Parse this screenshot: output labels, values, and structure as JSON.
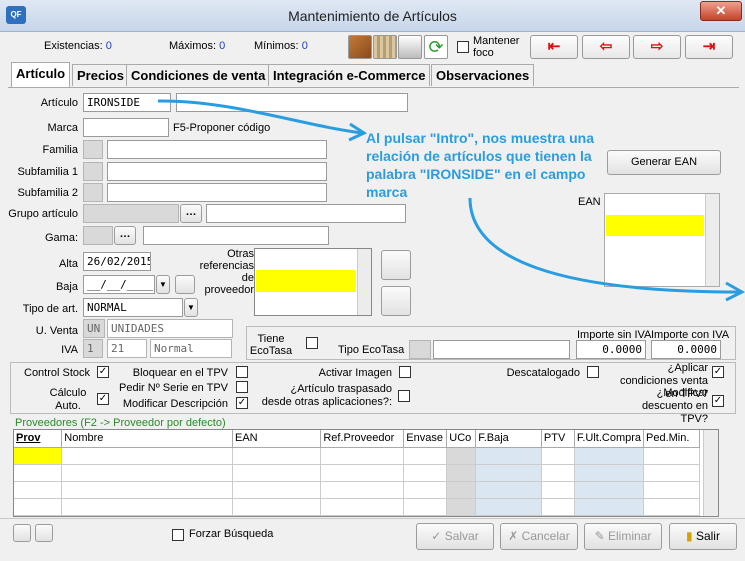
{
  "window": {
    "title": "Mantenimiento de Artículos",
    "app_icon": "QF"
  },
  "stats": {
    "existencias_label": "Existencias:",
    "existencias_value": "0",
    "maximos_label": "Máximos:",
    "maximos_value": "0",
    "minimos_label": "Mínimos:",
    "minimos_value": "0"
  },
  "toolbar": {
    "mantener_foco_label": "Mantener foco"
  },
  "tabs": [
    "Artículo",
    "Precios",
    "Condiciones de venta",
    "Integración e-Commerce",
    "Observaciones"
  ],
  "form": {
    "articulo_label": "Artículo",
    "articulo_value": "IRONSIDE",
    "marca_label": "Marca",
    "marca_hint": "F5-Proponer código",
    "familia_label": "Familia",
    "subfamilia1_label": "Subfamilia 1",
    "subfamilia2_label": "Subfamilia 2",
    "grupo_label": "Grupo artículo",
    "gama_label": "Gama:",
    "alta_label": "Alta",
    "alta_value": "26/02/2015",
    "baja_label": "Baja",
    "baja_value": "__/__/____",
    "tipo_label": "Tipo de art.",
    "tipo_value": "NORMAL",
    "uventa_label": "U. Venta",
    "uventa_code": "UN",
    "uventa_desc": "UNIDADES",
    "iva_label": "IVA",
    "iva_code": "1",
    "iva_pct": "21",
    "iva_desc": "Normal",
    "otras_refs_label": "Otras referencias de proveedor",
    "ean_button": "Generar EAN",
    "ean_label": "EAN",
    "ecotasa_label": "Tiene EcoTasa",
    "tipo_ecotasa_label": "Tipo EcoTasa",
    "importe_sin_iva_label": "Importe sin IVA",
    "importe_sin_iva": "0.0000",
    "importe_con_iva_label": "Importe con IVA",
    "importe_con_iva": "0.0000"
  },
  "options": {
    "control_stock": "Control Stock",
    "calculo_auto": "Cálculo Auto.",
    "bloquear_tpv": "Bloquear en el TPV",
    "pedir_serie": "Pedir Nº Serie en TPV",
    "modificar_desc": "Modificar Descripción",
    "activar_imagen": "Activar Imagen",
    "traspasado": "¿Artículo traspasado desde otras aplicaciones?:",
    "descatalogado": "Descatalogado",
    "aplicar_condiciones": "¿Aplicar condiciones venta en TPV?",
    "modificar_descuento": "¿Modificar descuento en TPV?"
  },
  "proveedores": {
    "title": "Proveedores (F2 -> Proveedor por defecto)",
    "columns": [
      "Prov",
      "Nombre",
      "EAN",
      "Ref.Proveedor",
      "Envase",
      "UCo",
      "F.Baja",
      "PTV",
      "F.Ult.Compra",
      "Ped.Min."
    ]
  },
  "footer": {
    "forzar_busqueda": "Forzar Búsqueda",
    "salvar": "Salvar",
    "cancelar": "Cancelar",
    "eliminar": "Eliminar",
    "salir": "Salir"
  },
  "annotation": "Al pulsar \"Intro\", nos muestra una relación de artículos que tienen la palabra \"IRONSIDE\" en el campo marca",
  "colors": {
    "highlight_yellow": "#ffff00",
    "annotation_blue": "#2a9de0",
    "nav_red": "#e01010"
  }
}
